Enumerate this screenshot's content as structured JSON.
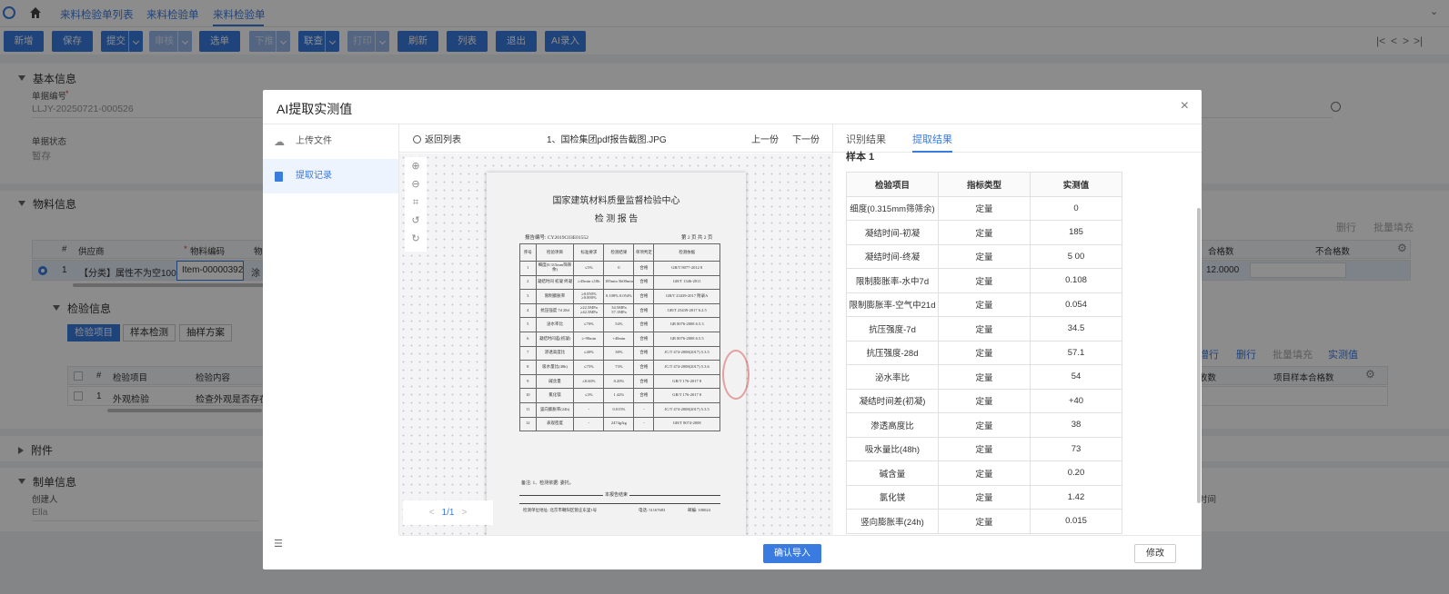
{
  "nav": {
    "tabs": [
      "来料检验单列表",
      "来料检验单",
      "来料检验单"
    ]
  },
  "toolbar": {
    "buttons": [
      "新增",
      "保存",
      "提交",
      "审核",
      "选单",
      "下推",
      "联查",
      "打印",
      "刷新",
      "列表",
      "退出",
      "AI录入"
    ]
  },
  "basic": {
    "title": "基本信息",
    "doc_no_label": "单据编号",
    "doc_no_value": "LLJY-20250721-000526",
    "status_label": "单据状态",
    "status_value": "暂存"
  },
  "material": {
    "title": "物料信息",
    "right_actions": [
      "删行",
      "批量填充"
    ],
    "columns": [
      "#",
      "供应商",
      "物料编码",
      "物"
    ],
    "row": {
      "idx": "1",
      "supplier": "【分类】属性不为空1007",
      "code": "Item-00000392",
      "name": "涂"
    },
    "right_columns": [
      "合格数",
      "不合格数"
    ],
    "qualified": "12.0000",
    "inspect_title": "检验信息",
    "inspect_tabs": [
      "检验项目",
      "样本检测",
      "抽样方案"
    ],
    "inspect_actions": [
      "增行",
      "删行",
      "批量填充",
      "实测值"
    ],
    "inspect_columns": [
      "#",
      "检验项目",
      "检验内容"
    ],
    "inspect_right_cols": [
      "收数",
      "项目样本合格数"
    ],
    "inspect_row": {
      "idx": "1",
      "item": "外观检验",
      "content": "检查外观是否存在"
    }
  },
  "attachment": {
    "title": "附件"
  },
  "maker": {
    "title": "制单信息",
    "creator_label": "创建人",
    "creator_value": "Ella",
    "time_label": "时间"
  },
  "modal": {
    "title": "AI提取实测值",
    "nav": [
      "上传文件",
      "提取记录"
    ],
    "back": "返回列表",
    "filename": "1、国检集团pdf报告截图.JPG",
    "prev": "上一份",
    "next": "下一份",
    "page": "1/1",
    "tabs": [
      "识别结果",
      "提取结果"
    ],
    "sample_title": "样本 1",
    "columns": [
      "检验项目",
      "指标类型",
      "实测值"
    ],
    "rows": [
      [
        "细度(0.315mm筛筛余)",
        "定量",
        "0"
      ],
      [
        "凝结时间-初凝",
        "定量",
        "185"
      ],
      [
        "凝结时间-终凝",
        "定量",
        "5 00"
      ],
      [
        "限制膨胀率-水中7d",
        "定量",
        "0.108"
      ],
      [
        "限制膨胀率-空气中21d",
        "定量",
        "0.054"
      ],
      [
        "抗压强度-7d",
        "定量",
        "34.5"
      ],
      [
        "抗压强度-28d",
        "定量",
        "57.1"
      ],
      [
        "泌水率比",
        "定量",
        "54"
      ],
      [
        "凝结时间差(初凝)",
        "定量",
        "+40"
      ],
      [
        "渗透高度比",
        "定量",
        "38"
      ],
      [
        "吸水量比(48h)",
        "定量",
        "73"
      ],
      [
        "碱含量",
        "定量",
        "0.20"
      ],
      [
        "氯化镁",
        "定量",
        "1.42"
      ],
      [
        "竖向膨胀率(24h)",
        "定量",
        "0.015"
      ]
    ],
    "confirm": "确认导入",
    "modify": "修改",
    "doc": {
      "org": "国家建筑材料质量监督检验中心",
      "title": "检 测 报 告",
      "report_no": "报告编号: CY2019C03E01552",
      "page_info": "第 2 页 共 2 页",
      "headers": [
        "序号",
        "检验项目",
        "标准要求",
        "检测结果",
        "单项判定",
        "检测依据"
      ],
      "rows": [
        [
          "1",
          "细度(0.315mm筛筛余)",
          "≤5%",
          "0",
          "合格",
          "GB/T 8077-2012 8"
        ],
        [
          "2",
          "凝结时间 初凝 终凝",
          "≥45min ≤10h",
          "185min 5h00min",
          "合格",
          "GB/T 1346-2011"
        ],
        [
          "3",
          "限制膨胀率",
          "≥0.050% ≥0.000%",
          "0.108% 0.054%",
          "合格",
          "GB/T 23439-2017 附录A"
        ],
        [
          "4",
          "抗压强度 7d 28d",
          "≥22.5MPa ≥42.5MPa",
          "34.5MPa 57.1MPa",
          "合格",
          "GB/T 23439-2017 6.2.5"
        ],
        [
          "5",
          "泌水率比",
          "≤70%",
          "54%",
          "合格",
          "GB 8076-2008 6.5.3"
        ],
        [
          "6",
          "凝结时间差(初凝)",
          "≥-90min",
          "+40min",
          "合格",
          "GB 8076-2008 6.5.5"
        ],
        [
          "7",
          "渗透高度比",
          "≤40%",
          "38%",
          "合格",
          "JC/T 474-2008(2017) 5.3.5"
        ],
        [
          "8",
          "吸水量比(48h)",
          "≤75%",
          "73%",
          "合格",
          "JC/T 474-2008(2017) 5.3.6"
        ],
        [
          "9",
          "碱含量",
          "≤0.60%",
          "0.20%",
          "合格",
          "GB/T 176-2017 8"
        ],
        [
          "10",
          "氯化镁",
          "≤3%",
          "1.42%",
          "合格",
          "GB/T 176-2017 8"
        ],
        [
          "11",
          "竖向膨胀率(24h)",
          "-",
          "0.015%",
          "-",
          "JC/T 474-2008(2017) 5.3.5"
        ],
        [
          "12",
          "表观密度",
          "-",
          "2474g/kg",
          "-",
          "GB/T 8074-2008"
        ]
      ],
      "remark": "备注: 1、检测依据: 委托。",
      "end": "本报告结束",
      "address": "检测单位地址: 北京市朝阳区管庄东里1号",
      "tel": "电话: 51167683",
      "zip": "邮编: 100024"
    }
  }
}
